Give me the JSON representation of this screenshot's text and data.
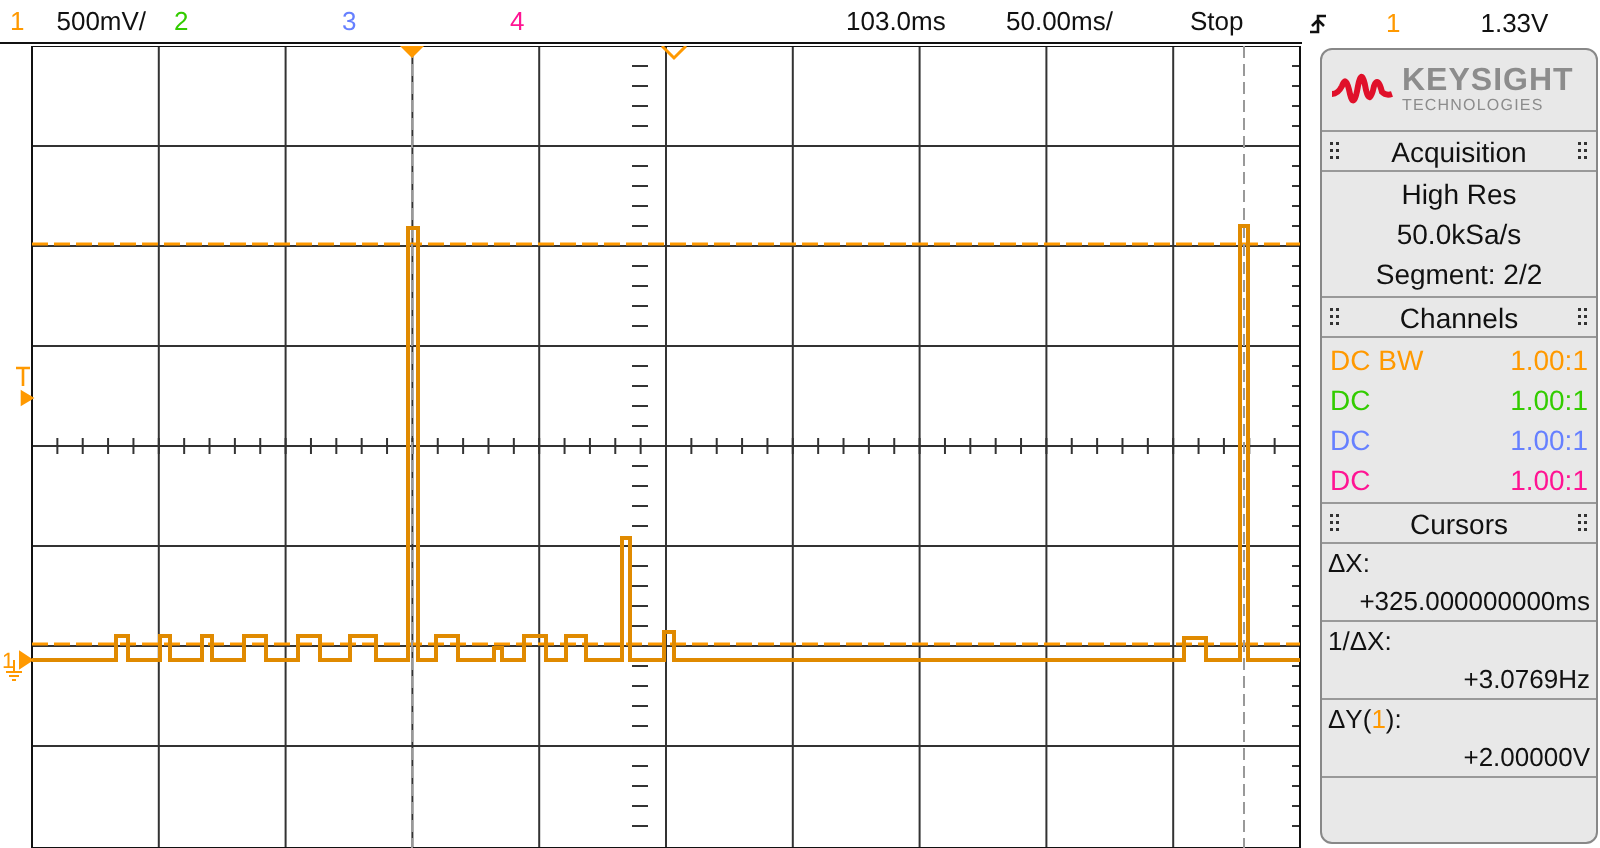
{
  "top_bar": {
    "channels": [
      {
        "label": "1",
        "color": "#ff9900",
        "scale": "500mV/"
      },
      {
        "label": "2",
        "color": "#33cc00"
      },
      {
        "label": "3",
        "color": "#6680ff"
      },
      {
        "label": "4",
        "color": "#ff1493"
      }
    ],
    "delay": "103.0ms",
    "timebase": "50.00ms/",
    "run_state": "Stop",
    "trigger": {
      "source": "1",
      "color": "#ff9900",
      "level": "1.33V"
    }
  },
  "plot": {
    "ground_marker": "1"
  },
  "logo": {
    "brand": "KEYSIGHT",
    "subtitle": "TECHNOLOGIES"
  },
  "acquisition": {
    "title": "Acquisition",
    "lines": [
      "High Res",
      "50.0kSa/s",
      "Segment: 2/2"
    ]
  },
  "channels_panel": {
    "title": "Channels",
    "rows": [
      {
        "coupling": "DC BW",
        "ratio": "1.00:1",
        "color": "#ff9900"
      },
      {
        "coupling": "DC",
        "ratio": "1.00:1",
        "color": "#33cc00"
      },
      {
        "coupling": "DC",
        "ratio": "1.00:1",
        "color": "#6680ff"
      },
      {
        "coupling": "DC",
        "ratio": "1.00:1",
        "color": "#ff1493"
      }
    ]
  },
  "cursors": {
    "title": "Cursors",
    "items": [
      {
        "kind": "plain",
        "label": "ΔX:",
        "value": "+325.000000000ms"
      },
      {
        "kind": "plain",
        "label": "1/ΔX:",
        "value": "+3.0769Hz"
      },
      {
        "kind": "channel",
        "label": "ΔY(",
        "source": "1",
        "color": "#ff9900",
        "label_end": "):",
        "value": "+2.00000V"
      }
    ]
  }
}
